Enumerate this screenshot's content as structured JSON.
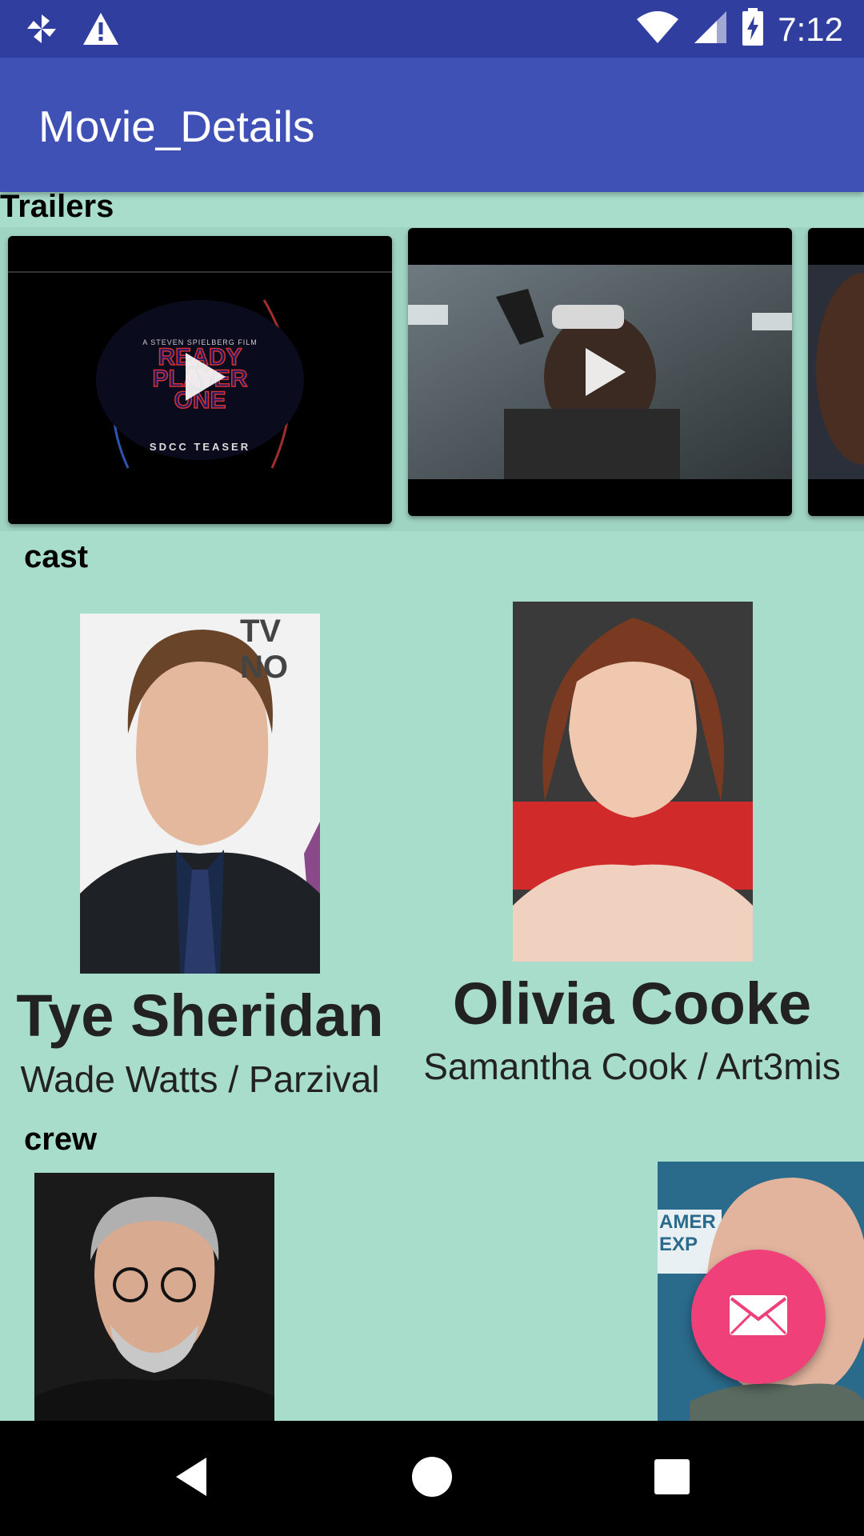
{
  "status_bar": {
    "time": "7:12",
    "icons": [
      "pinwheel-icon",
      "warning-icon",
      "wifi-icon",
      "signal-icon",
      "battery-charging-icon"
    ]
  },
  "app_bar": {
    "title": "Movie_Details"
  },
  "trailers": {
    "label": "Trailers",
    "items": [
      {
        "name": "trailer-1",
        "poster_lines": [
          "A STEVEN SPIELBERG FILM",
          "READY",
          "PLAYER",
          "ONE",
          "SDCC TEASER"
        ]
      },
      {
        "name": "trailer-2"
      },
      {
        "name": "trailer-3"
      }
    ]
  },
  "cast": {
    "label": "cast",
    "members": [
      {
        "name": "Tye Sheridan",
        "role": "Wade Watts / Parzival",
        "photo_overlay": "TV NO"
      },
      {
        "name": "Olivia Cooke",
        "role": "Samantha Cook / Art3mis"
      }
    ]
  },
  "crew": {
    "label": "crew",
    "members": [
      {
        "photo": "crew-photo-1"
      },
      {
        "photo": "crew-photo-2",
        "photo_overlay": "AMER EXP"
      }
    ]
  },
  "fab": {
    "icon": "mail-icon"
  },
  "nav_bar": {
    "icons": [
      "back-icon",
      "home-icon",
      "recents-icon"
    ]
  },
  "colors": {
    "status_bar": "#303f9f",
    "app_bar": "#3f51b5",
    "background": "#a8dccb",
    "fab": "#f0407a"
  }
}
